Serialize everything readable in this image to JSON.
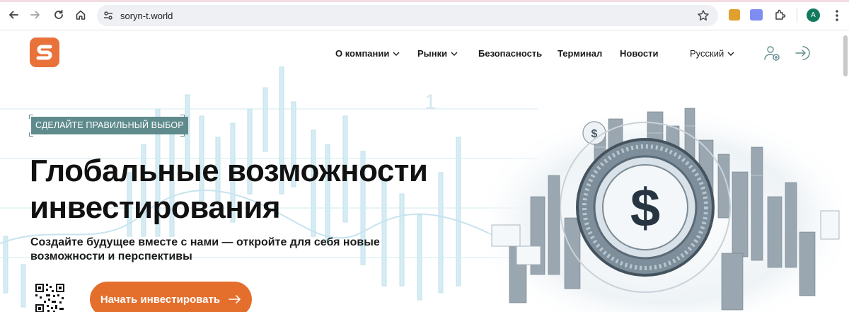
{
  "browser": {
    "url": "soryn-t.world",
    "profile_initial": "A",
    "extensions": [
      {
        "name": "extension-1",
        "color": "#e0a030"
      },
      {
        "name": "extension-2",
        "color": "#7f8cf0"
      }
    ]
  },
  "site": {
    "logo_letter": "S",
    "brand_color": "#e8723a",
    "nav": [
      {
        "label": "О компании",
        "dropdown": true
      },
      {
        "label": "Рынки",
        "dropdown": true
      },
      {
        "label": "Безопасность",
        "dropdown": false
      },
      {
        "label": "Терминал",
        "dropdown": false
      },
      {
        "label": "Новости",
        "dropdown": false
      }
    ],
    "language": "Русский"
  },
  "hero": {
    "badge": "СДЕЛАЙТЕ ПРАВИЛЬНЫЙ ВЫБОР",
    "title_line1": "Глобальные возможности",
    "title_line2": "инвестирования",
    "subtitle_line1": "Создайте будущее вместе с нами — откройте для себя новые",
    "subtitle_line2": "возможности и перспективы",
    "cta_label": "Начать инвестировать",
    "cta_color": "#e46f2d",
    "image_symbol": "$"
  }
}
